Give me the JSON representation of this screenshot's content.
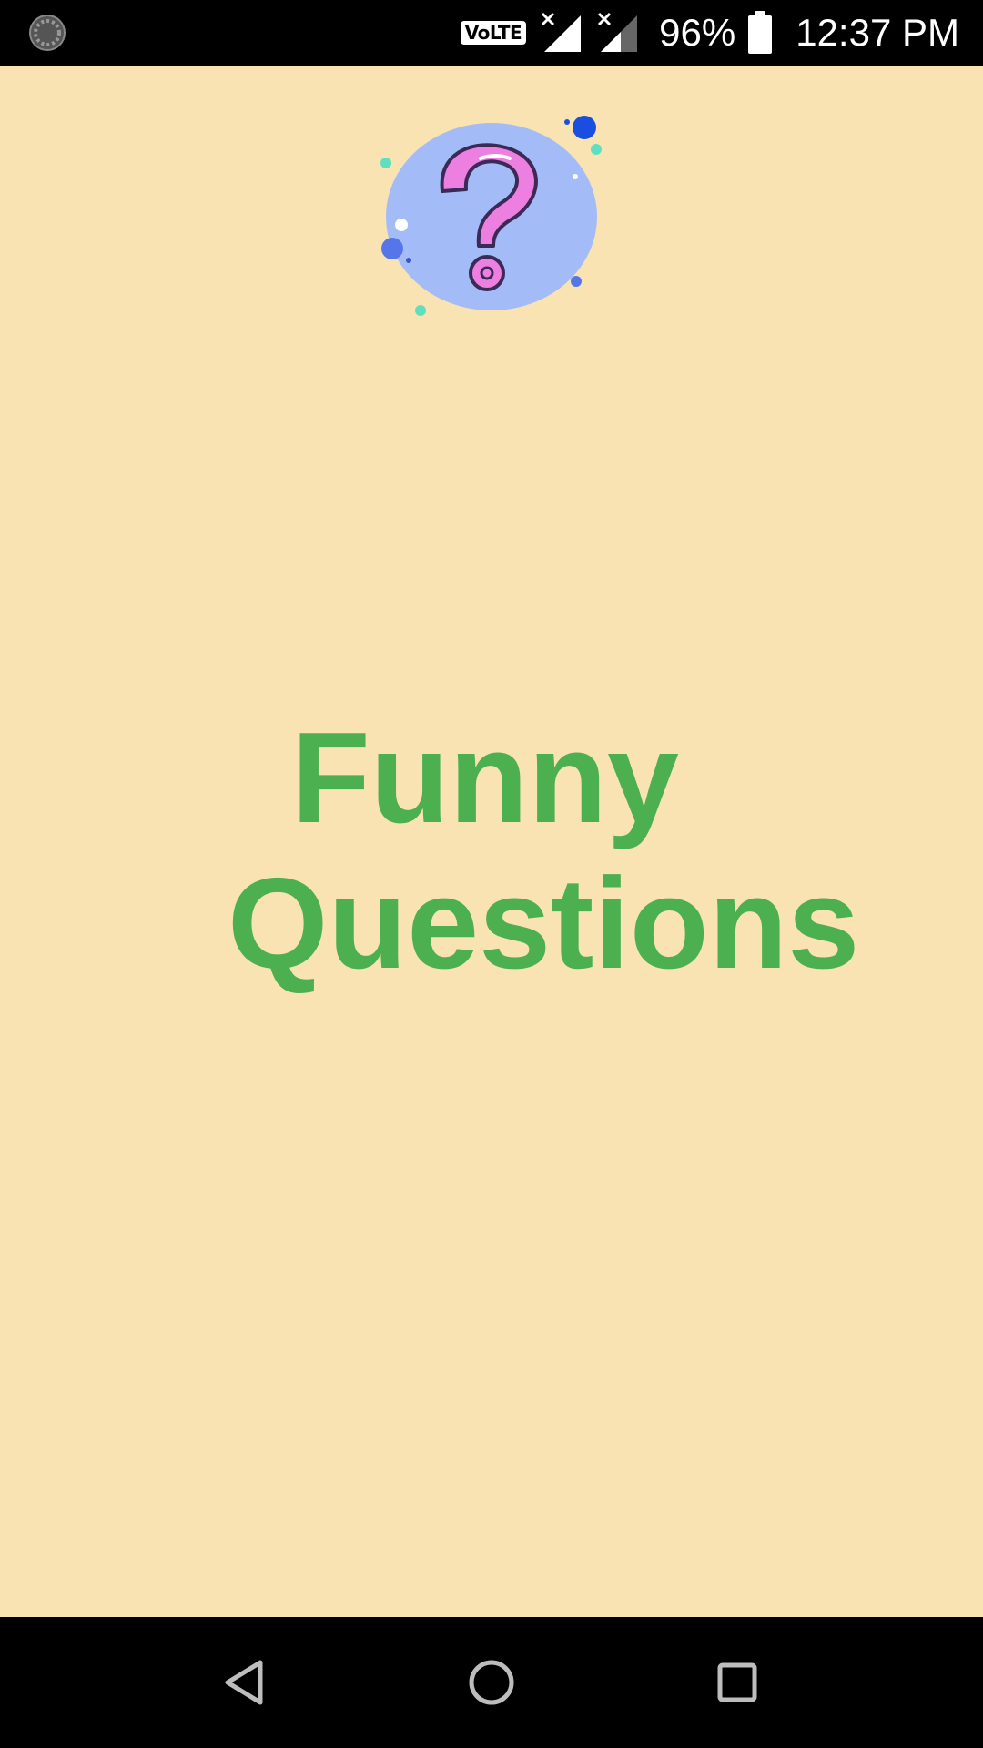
{
  "status_bar": {
    "left_icon": "sync-icon",
    "network_badge": "VoLTE",
    "signal_icons": [
      "signal-no-data-icon",
      "signal-weak-no-data-icon"
    ],
    "battery_percent": "96%",
    "battery_icon": "battery-icon",
    "time": "12:37 PM"
  },
  "app": {
    "logo_icon": "question-mark-icon",
    "title_line_1": "Funny",
    "title_line_2": "Questions",
    "colors": {
      "background": "#f9e3b3",
      "title": "#4caf50",
      "logo_circle": "#a3bcf8",
      "question_mark": "#ec7fe0"
    }
  },
  "nav_bar": {
    "back_icon": "back-triangle-icon",
    "home_icon": "home-circle-icon",
    "recents_icon": "recents-square-icon"
  }
}
